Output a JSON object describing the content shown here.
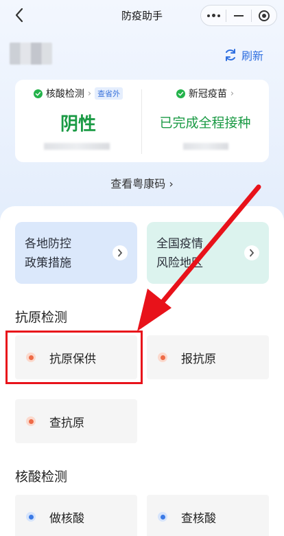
{
  "nav": {
    "title": "防疫助手"
  },
  "header": {
    "refresh_label": "刷新"
  },
  "status": {
    "nucleic": {
      "label": "核酸检测",
      "tag": "查省外",
      "value": "阴性"
    },
    "vaccine": {
      "label": "新冠疫苗",
      "value": "已完成全程接种"
    },
    "view_code_label": "查看粤康码 ›"
  },
  "quick_tiles": [
    {
      "label_line1": "各地防控",
      "label_line2": "政策措施"
    },
    {
      "label_line1": "全国疫情",
      "label_line2": "风险地区"
    }
  ],
  "antigen": {
    "title": "抗原检测",
    "items": [
      "抗原保供",
      "报抗原",
      "查抗原"
    ]
  },
  "nucleic_section": {
    "title": "核酸检测",
    "items": [
      "做核酸",
      "查核酸"
    ]
  },
  "colors": {
    "accent": "#2f6fe0",
    "positive_green": "#1a9a44",
    "highlight_red": "#e8121a"
  }
}
